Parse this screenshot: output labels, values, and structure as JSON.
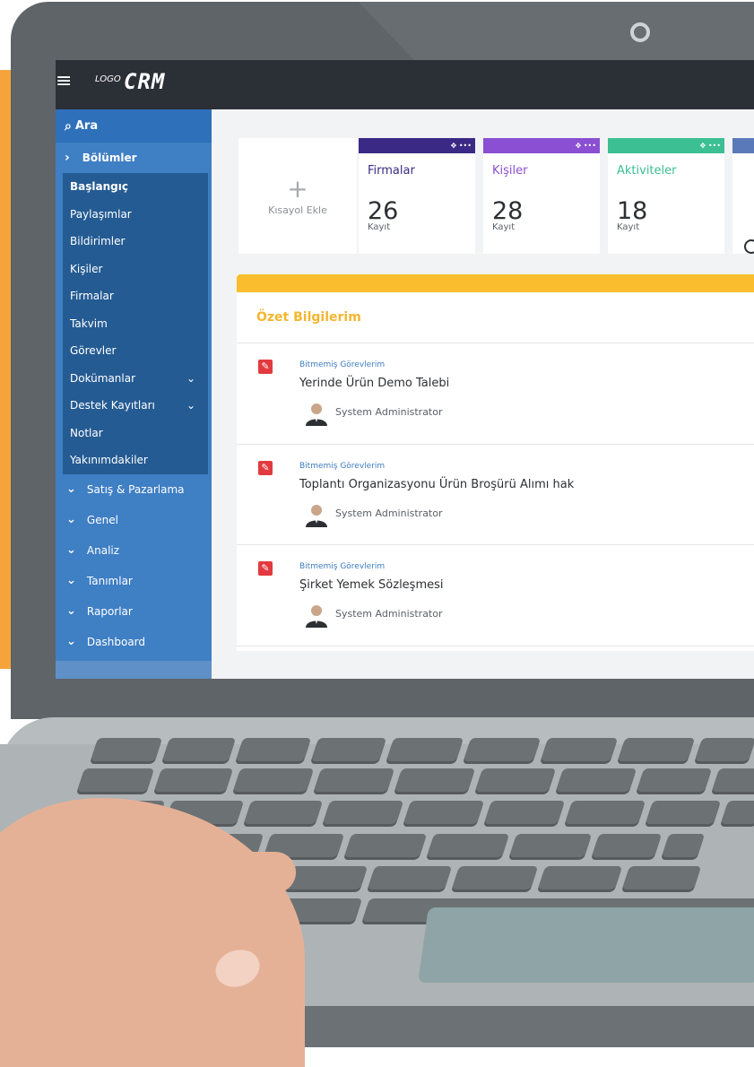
{
  "app": {
    "logo_small": "LOGO",
    "logo_big": "CRM"
  },
  "sidebar": {
    "search_label": "Ara",
    "section_label": "Bölümler",
    "items": [
      {
        "label": "Başlangıç",
        "active": true
      },
      {
        "label": "Paylaşımlar"
      },
      {
        "label": "Bildirimler"
      },
      {
        "label": "Kişiler"
      },
      {
        "label": "Firmalar"
      },
      {
        "label": "Takvim"
      },
      {
        "label": "Görevler"
      },
      {
        "label": "Dokümanlar",
        "expandable": true
      },
      {
        "label": "Destek Kayıtları",
        "expandable": true
      },
      {
        "label": "Notlar"
      },
      {
        "label": "Yakınımdakiler"
      }
    ],
    "groups": [
      {
        "label": "Satış & Pazarlama"
      },
      {
        "label": "Genel"
      },
      {
        "label": "Analiz"
      },
      {
        "label": "Tanımlar"
      },
      {
        "label": "Raporlar"
      },
      {
        "label": "Dashboard"
      }
    ]
  },
  "shortcuts": {
    "add_label": "Kısayol Ekle",
    "cards": [
      {
        "title": "Firmalar",
        "count": "26",
        "sub": "Kayıt",
        "color": "#3b2a85"
      },
      {
        "title": "Kişiler",
        "count": "28",
        "sub": "Kayıt",
        "color": "#8a4fd2"
      },
      {
        "title": "Aktiviteler",
        "count": "18",
        "sub": "Kayıt",
        "color": "#3bbf93"
      }
    ]
  },
  "summary": {
    "title": "Özet Bilgilerim",
    "tasks": [
      {
        "category": "Bitmemiş Görevlerim",
        "name": "Yerinde Ürün Demo Talebi",
        "user": "System Administrator"
      },
      {
        "category": "Bitmemiş Görevlerim",
        "name": "Toplantı Organizasyonu Ürün Broşürü Alımı hak",
        "user": "System Administrator"
      },
      {
        "category": "Bitmemiş Görevlerim",
        "name": "Şirket Yemek Sözleşmesi",
        "user": "System Administrator"
      }
    ]
  }
}
